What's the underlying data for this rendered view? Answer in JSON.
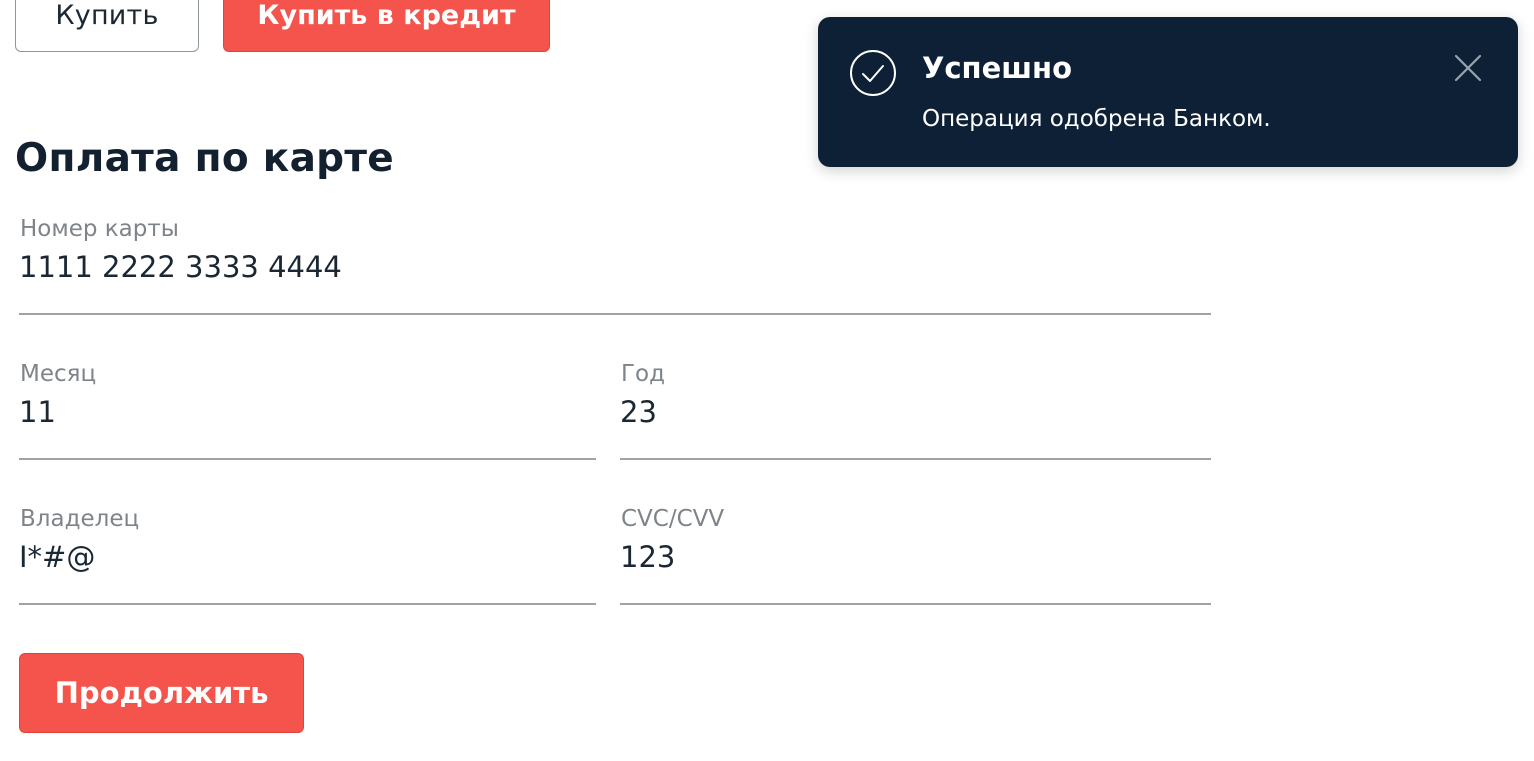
{
  "top_buttons": {
    "buy_label": "Купить",
    "buy_credit_label": "Купить в кредит"
  },
  "form": {
    "title": "Оплата по карте",
    "card_number": {
      "label": "Номер карты",
      "value": "1111 2222 3333 4444"
    },
    "month": {
      "label": "Месяц",
      "value": "11"
    },
    "year": {
      "label": "Год",
      "value": "23"
    },
    "owner": {
      "label": "Владелец",
      "value": "I*#@"
    },
    "cvc": {
      "label": "CVC/CVV",
      "value": "123"
    },
    "continue_label": "Продолжить"
  },
  "notification": {
    "title": "Успешно",
    "message": "Операция одобрена Банком.",
    "icon": "check-circle-icon",
    "close_icon": "close-icon"
  },
  "colors": {
    "accent": "#f4544b",
    "toast_bg": "#0e2036",
    "text": "#1b2733",
    "label": "#7d848a"
  }
}
